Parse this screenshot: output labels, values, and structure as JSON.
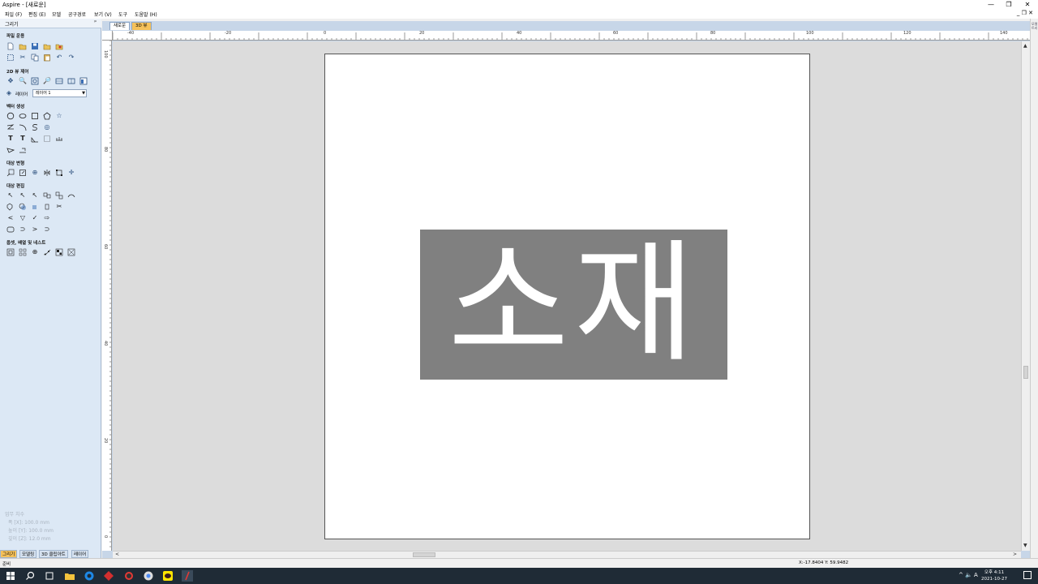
{
  "window": {
    "title": "Aspire - [새로운]",
    "min_glyph": "—",
    "max_glyph": "❐",
    "close_glyph": "✕",
    "mdi_controls": "_ ❐ ✕"
  },
  "menu": [
    "파일 (F)",
    "편집 (E)",
    "모델",
    "공구경로",
    "보기 (V)",
    "도구",
    "도움말 (H)"
  ],
  "panel": {
    "title": "그리기",
    "pin": "ᵖ",
    "sections": {
      "file": "파일 운용",
      "view2d": "2D 뷰 제어",
      "vector": "벡터 생성",
      "transform": "대상 변형",
      "edit": "대상 편집",
      "offset": "옵셋, 배열 및 네스트"
    },
    "layer_label": "레이어",
    "layer_value": "레이어 1",
    "layer_arrow": "▼",
    "job_title": "업무 치수",
    "job_width": "폭 [X]: 100.0 mm",
    "job_height": "높이 [Y]: 100.0 mm",
    "job_depth": "깊이 [Z]: 12.0 mm",
    "bottom_tabs": [
      "그리기",
      "모델링",
      "3D 클립아트",
      "레이어"
    ]
  },
  "doc_tabs": [
    "새로운",
    "3D 뷰"
  ],
  "rulers": {
    "h_labels": [
      "-40",
      "-20",
      "0",
      "20",
      "40",
      "60",
      "80",
      "100",
      "120",
      "140"
    ],
    "v_labels": [
      "100",
      "80",
      "60",
      "40",
      "20",
      "0"
    ]
  },
  "canvas": {
    "material_text": "소재",
    "material_color": "#808080",
    "page_color": "#ffffff",
    "background_color": "#dcdcdc"
  },
  "scroll": {
    "left": "<",
    "right": ">",
    "up": "▲",
    "down": "▼"
  },
  "right_strip_label": "모델 트리",
  "status": {
    "text": "준비",
    "coords": "X:-17.8404 Y: 59.9482"
  },
  "taskbar": {
    "time": "오후 4:11",
    "date": "2021-10-27",
    "tray": "^  🔈  A"
  }
}
